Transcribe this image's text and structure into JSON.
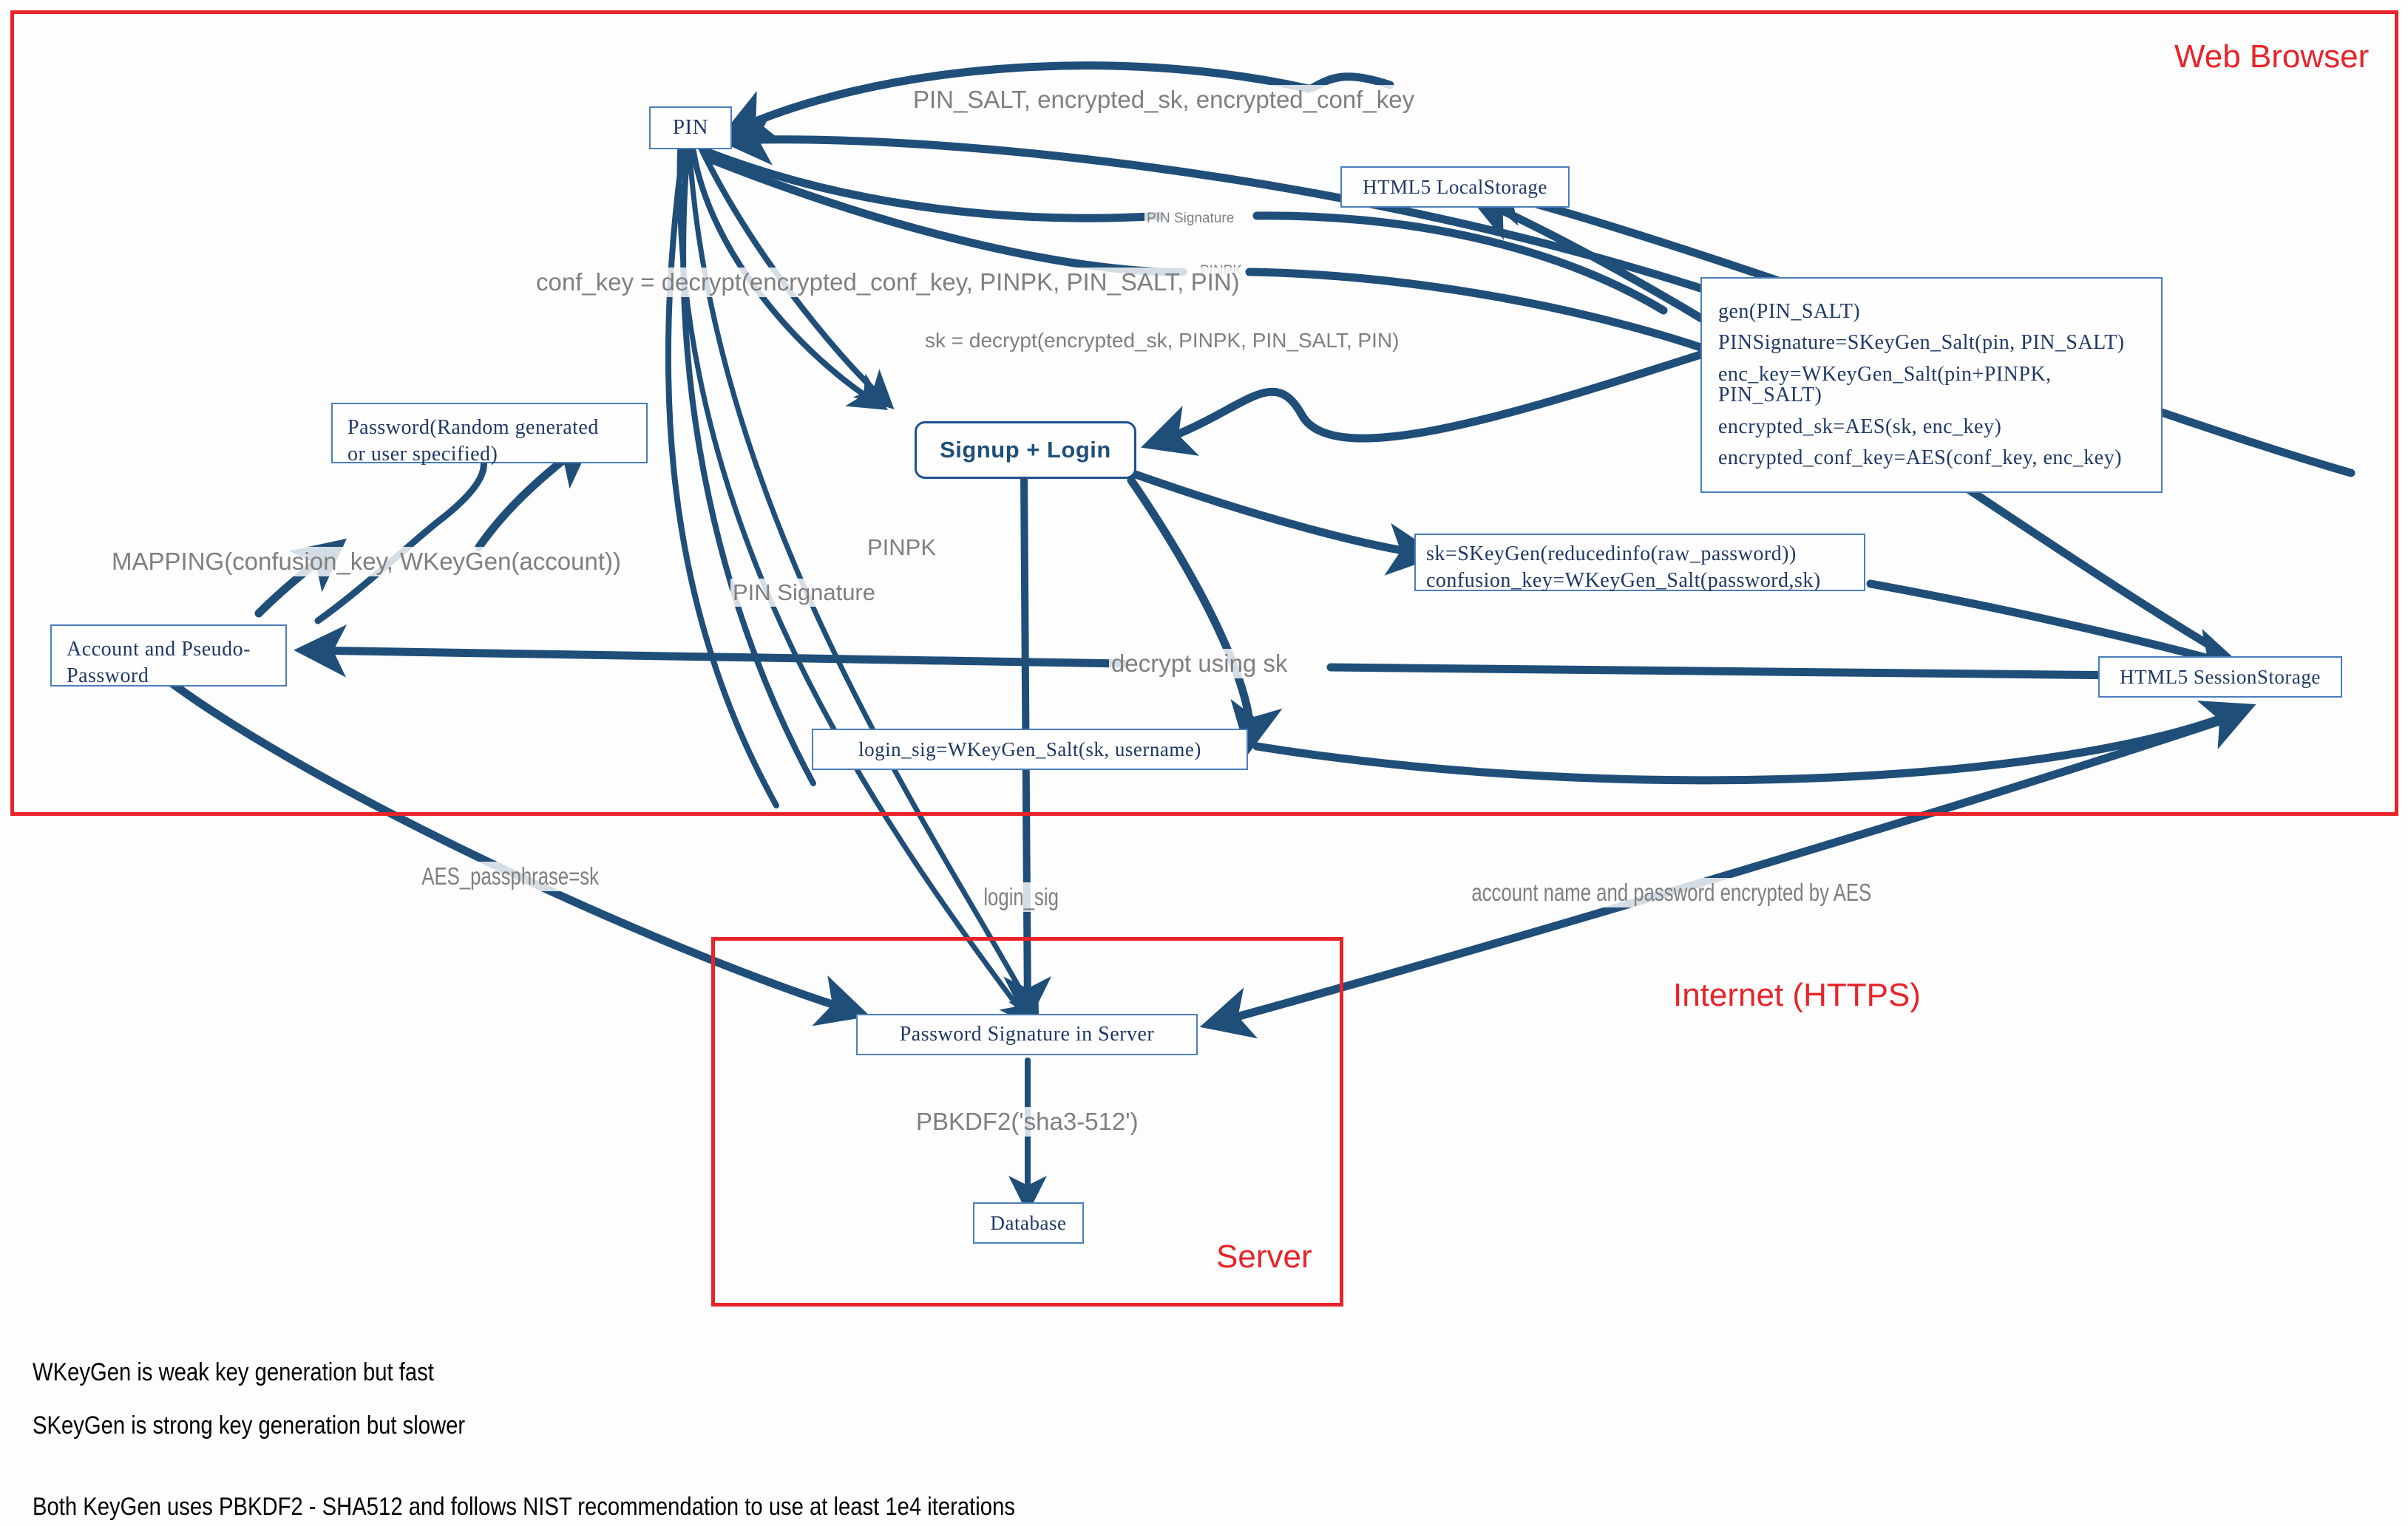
{
  "zones": [
    {
      "name": "web-browser",
      "label": "Web Browser"
    },
    {
      "name": "internet",
      "label": "Internet (HTTPS)"
    },
    {
      "name": "server",
      "label": "Server"
    }
  ],
  "nodes": {
    "pin": {
      "label": "PIN"
    },
    "local_storage": {
      "label": "HTML5 LocalStorage"
    },
    "session_storage": {
      "label": "HTML5 SessionStorage"
    },
    "signup_login": {
      "label": "Signup + Login"
    },
    "password_box": {
      "line1": "Password(Random generated",
      "line2": "or user specified)"
    },
    "account_pseudo": {
      "line1": "Account and Pseudo-",
      "line2": "Password"
    },
    "login_sig_box": {
      "label": "login_sig=WKeyGen_Salt(sk, username)"
    },
    "skeygen_box": {
      "line1": "sk=SKeyGen(reducedinfo(raw_password))",
      "line2": "confusion_key=WKeyGen_Salt(password,sk)"
    },
    "crypto_box": {
      "lines": [
        "gen(PIN_SALT)",
        "PINSignature=SKeyGen_Salt(pin, PIN_SALT)",
        "enc_key=WKeyGen_Salt(pin+PINPK, PIN_SALT)",
        "encrypted_sk=AES(sk, enc_key)",
        "encrypted_conf_key=AES(conf_key, enc_key)"
      ]
    },
    "password_signature": {
      "label": "Password Signature in Server"
    },
    "database": {
      "label": "Database"
    }
  },
  "edge_labels": {
    "pin_salt_bundle": "PIN_SALT, encrypted_sk, encrypted_conf_key",
    "pin_signature_sm": "PIN Signature",
    "pinpk_sm": "PINPK",
    "conf_key_decrypt": "conf_key = decrypt(encrypted_conf_key, PINPK, PIN_SALT, PIN)",
    "sk_decrypt": "sk = decrypt(encrypted_sk, PINPK, PIN_SALT, PIN)",
    "pinpk_md": "PINPK",
    "pin_signature_md": "PIN Signature",
    "mapping": "MAPPING(confusion_key, WKeyGen(account))",
    "decrypt_using_sk": "decrypt using sk",
    "aes_passphrase": "AES_passphrase=sk",
    "login_sig": "login_sig",
    "account_encrypted": "account name and password encrypted by AES",
    "pbkdf2": "PBKDF2('sha3-512')"
  },
  "notes": [
    "WKeyGen is weak key generation but fast",
    "SKeyGen is strong key generation but slower",
    "Both KeyGen uses PBKDF2 - SHA512 and follows NIST recommendation to use at least 1e4 iterations"
  ],
  "colors": {
    "zone_red": "#e8232a",
    "edge_blue": "#1f4e79",
    "node_border": "#4a7ebb",
    "node_text": "#1f3864",
    "label_gray": "#7f7f7f"
  }
}
